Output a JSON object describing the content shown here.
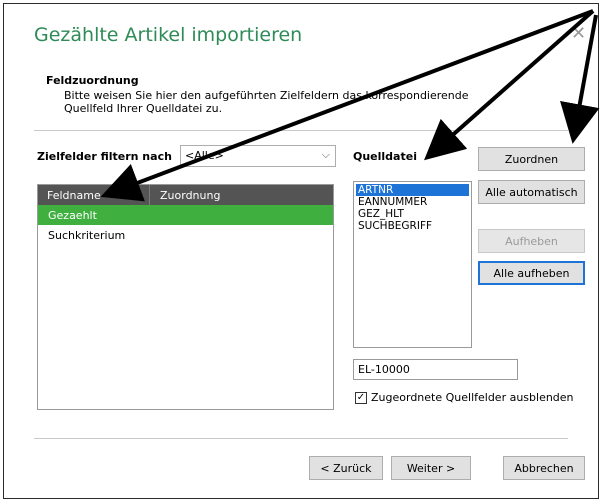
{
  "dialog": {
    "title": "Gezählte Artikel importieren",
    "close_label": "✕"
  },
  "section": {
    "title": "Feldzuordnung",
    "description": "Bitte weisen Sie hier den aufgeführten Zielfeldern das korrespondierende Quellfeld Ihrer Quelldatei zu."
  },
  "filter": {
    "label": "Zielfelder filtern nach",
    "value": "<Alle>",
    "chevron": "⌵"
  },
  "grid": {
    "columns": [
      "Feldname",
      "Zuordnung"
    ],
    "rows": [
      {
        "name": "Gezaehlt",
        "mapping": ""
      },
      {
        "name": "Suchkriterium",
        "mapping": ""
      }
    ]
  },
  "source": {
    "label": "Quelldatei",
    "items": [
      "ARTNR",
      "EANNUMMER",
      "GEZ_HLT",
      "SUCHBEGRIFF"
    ],
    "selected_index": 0
  },
  "buttons": {
    "assign": "Zuordnen",
    "assign_all": "Alle automatisch",
    "remove": "Aufheben",
    "remove_all": "Alle aufheben",
    "back": "< Zurück",
    "next": "Weiter >",
    "cancel": "Abbrechen"
  },
  "code_input": {
    "value": "EL-10000"
  },
  "hide_mapped": {
    "label": "Zugeordnete Quellfelder ausblenden",
    "checked": true,
    "check_glyph": "✓"
  },
  "colors": {
    "title": "#2e8b57",
    "selected_row": "#3faf3f",
    "selected_item": "#1e74d6",
    "header": "#545454"
  }
}
